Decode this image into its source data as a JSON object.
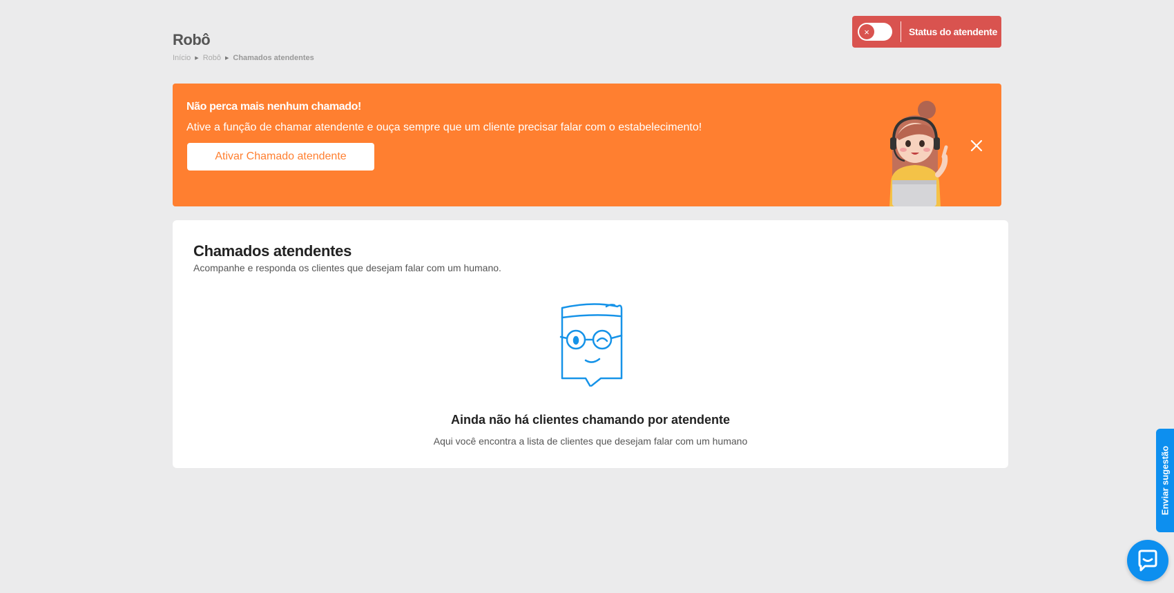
{
  "header": {
    "title": "Robô",
    "breadcrumb": [
      "Início",
      "Robô",
      "Chamados atendentes"
    ]
  },
  "status": {
    "label": "Status do atendente",
    "toggle_on": false,
    "color": "#d9534f"
  },
  "banner": {
    "title": "Não perca mais nenhum chamado!",
    "text": "Ative a função de chamar atendente e ouça sempre que um cliente precisar falar com o estabelecimento!",
    "button_label": "Ativar Chamado atendente",
    "color": "#ff7f30",
    "close_icon": "close-icon"
  },
  "card": {
    "title": "Chamados atendentes",
    "subtitle": "Acompanhe e responda os clientes que desejam falar com um humano.",
    "empty_title": "Ainda não há clientes chamando por atendente",
    "empty_text": "Aqui você encontra a lista de clientes que desejam falar com um humano"
  },
  "widgets": {
    "suggest_label": "Enviar sugestão",
    "chat_icon": "chat-bubble-icon",
    "accent": "#0d8fef"
  }
}
